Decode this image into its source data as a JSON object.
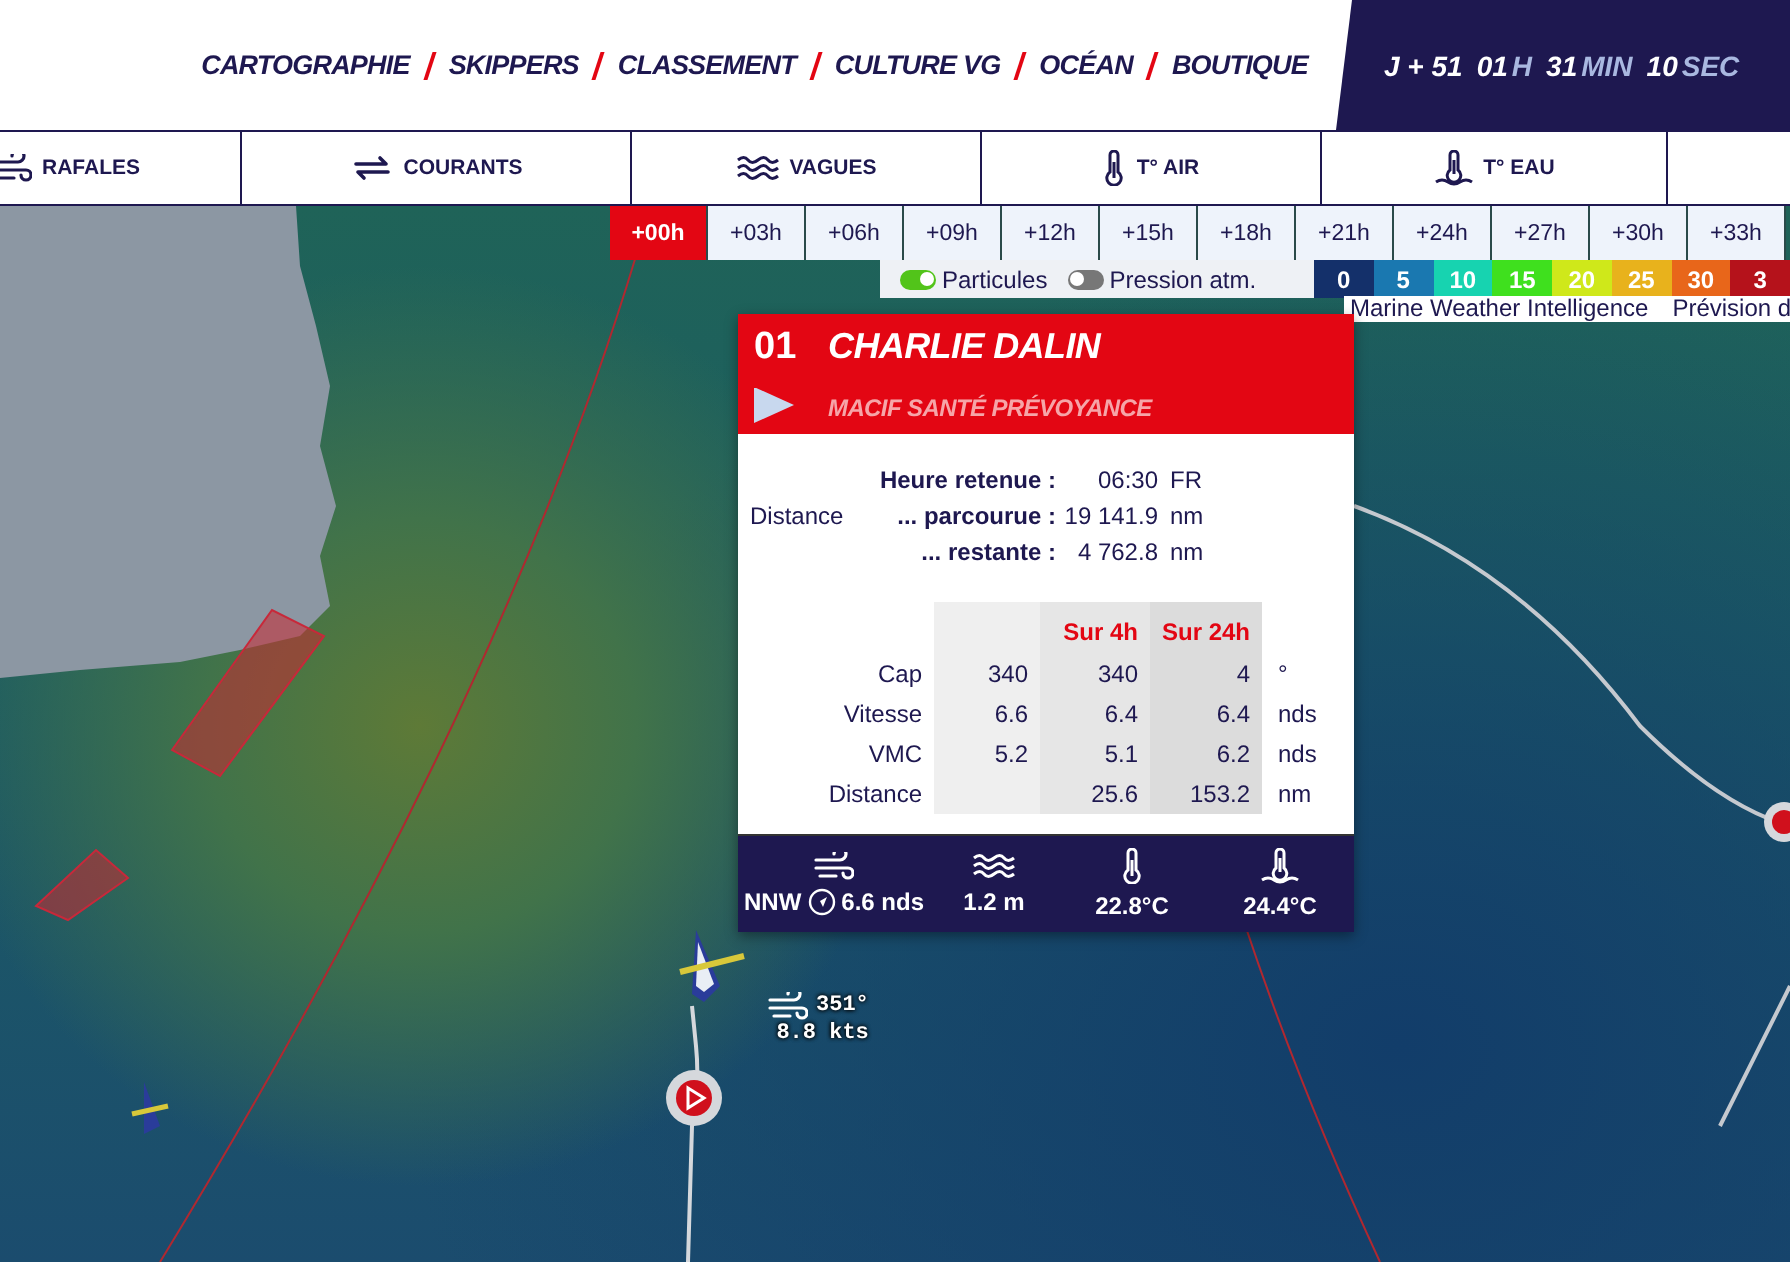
{
  "header": {
    "nav": [
      "CARTOGRAPHIE",
      "SKIPPERS",
      "CLASSEMENT",
      "CULTURE VG",
      "OCÉAN",
      "BOUTIQUE"
    ],
    "countdown": {
      "day": "J + 51",
      "parts": [
        {
          "value": "01",
          "unit": "H"
        },
        {
          "value": "31",
          "unit": "MIN"
        },
        {
          "value": "10",
          "unit": "SEC"
        }
      ]
    }
  },
  "layers": [
    {
      "label": "RAFALES",
      "kind": "gusts"
    },
    {
      "label": "COURANTS",
      "kind": "currents"
    },
    {
      "label": "VAGUES",
      "kind": "waves"
    },
    {
      "label": "T° AIR",
      "kind": "air"
    },
    {
      "label": "T° EAU",
      "kind": "water"
    }
  ],
  "time_slots": [
    {
      "label": "+00h",
      "selected": true
    },
    {
      "label": "+03h",
      "selected": false
    },
    {
      "label": "+06h",
      "selected": false
    },
    {
      "label": "+09h",
      "selected": false
    },
    {
      "label": "+12h",
      "selected": false
    },
    {
      "label": "+15h",
      "selected": false
    },
    {
      "label": "+18h",
      "selected": false
    },
    {
      "label": "+21h",
      "selected": false
    },
    {
      "label": "+24h",
      "selected": false
    },
    {
      "label": "+27h",
      "selected": false
    },
    {
      "label": "+30h",
      "selected": false
    },
    {
      "label": "+33h",
      "selected": false
    }
  ],
  "toggles": [
    {
      "label": "Particules",
      "on": true
    },
    {
      "label": "Pression atm.",
      "on": false
    }
  ],
  "legend": [
    {
      "label": "0",
      "color": "#14306a"
    },
    {
      "label": "5",
      "color": "#1a78b0"
    },
    {
      "label": "10",
      "color": "#17d3b0"
    },
    {
      "label": "15",
      "color": "#3fe01e"
    },
    {
      "label": "20",
      "color": "#cfe81a"
    },
    {
      "label": "25",
      "color": "#e8b21c"
    },
    {
      "label": "30",
      "color": "#e8661a"
    },
    {
      "label": "3",
      "color": "#b5121b"
    }
  ],
  "attribution": [
    "Marine Weather Intelligence",
    "Prévision d"
  ],
  "popup": {
    "rank": "01",
    "name": "CHARLIE DALIN",
    "boat": "MACIF SANTÉ PRÉVOYANCE",
    "info_group": "Distance",
    "info": [
      {
        "label": "Heure retenue :",
        "value": "06:30",
        "unit": "FR"
      },
      {
        "label": "... parcourue :",
        "value": "19 141.9",
        "unit": "nm"
      },
      {
        "label": "... restante :",
        "value": "4 762.8",
        "unit": "nm"
      }
    ],
    "stats": {
      "columns": [
        "Sur 4h",
        "Sur 24h"
      ],
      "rows": [
        {
          "label": "Cap",
          "values": [
            "340",
            "340",
            "4"
          ],
          "unit": "°"
        },
        {
          "label": "Vitesse",
          "values": [
            "6.6",
            "6.4",
            "6.4"
          ],
          "unit": "nds"
        },
        {
          "label": "VMC",
          "values": [
            "5.2",
            "5.1",
            "6.2"
          ],
          "unit": "nds"
        },
        {
          "label": "Distance",
          "values": [
            "25.6",
            "153.2"
          ],
          "unit": "nm"
        }
      ]
    },
    "conditions": [
      {
        "kind": "wind",
        "direction": "NNW",
        "value": "6.6 nds"
      },
      {
        "kind": "waves",
        "value": "1.2 m"
      },
      {
        "kind": "air",
        "value": "22.8°C"
      },
      {
        "kind": "water",
        "value": "24.4°C"
      }
    ]
  },
  "boat_label": {
    "heading": "351°",
    "speed": "8.8 kts"
  }
}
